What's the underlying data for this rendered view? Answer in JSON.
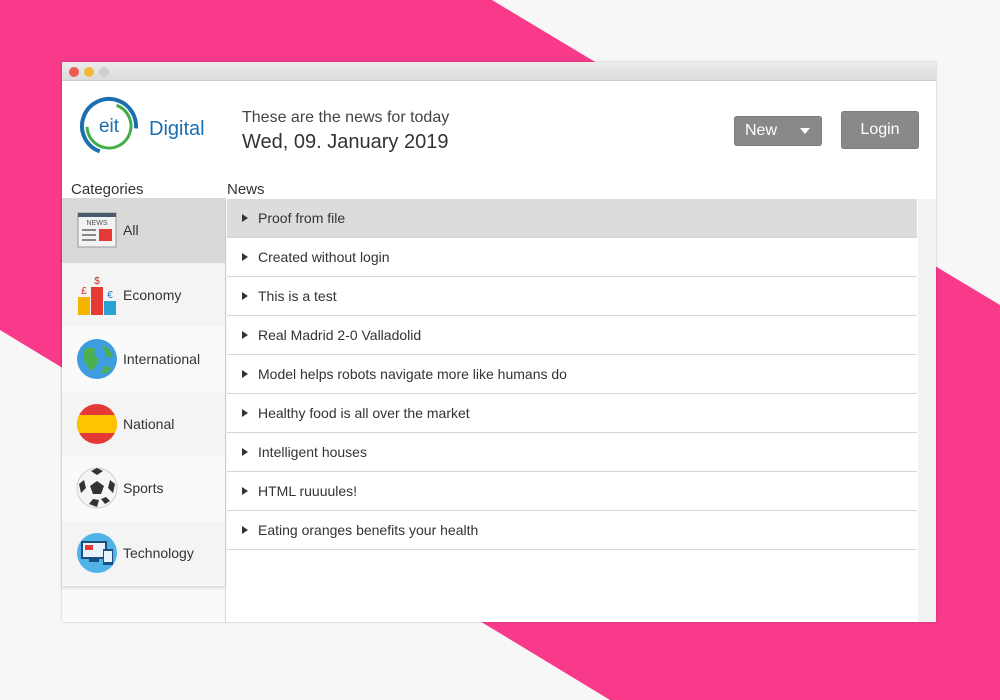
{
  "colors": {
    "accent_pink": "#f93a8b",
    "brand_blue": "#1b6fb0",
    "brand_green": "#3fae49",
    "button_gray": "#898989"
  },
  "header": {
    "logo_mark": "eit",
    "logo_text": "Digital",
    "subtitle": "These are the news for today",
    "date": "Wed, 09. January 2019",
    "new_button": "New",
    "login_button": "Login"
  },
  "labels": {
    "categories": "Categories",
    "news": "News"
  },
  "categories": [
    {
      "label": "All",
      "icon": "newspaper-icon",
      "selected": true
    },
    {
      "label": "Economy",
      "icon": "currency-podium-icon"
    },
    {
      "label": "International",
      "icon": "globe-icon"
    },
    {
      "label": "National",
      "icon": "spain-flag-icon"
    },
    {
      "label": "Sports",
      "icon": "soccer-ball-icon"
    },
    {
      "label": "Technology",
      "icon": "computer-devices-icon"
    }
  ],
  "news": [
    {
      "title": "Proof from file",
      "selected": true
    },
    {
      "title": "Created without login"
    },
    {
      "title": "This is a test"
    },
    {
      "title": "Real Madrid 2-0 Valladolid"
    },
    {
      "title": "Model helps robots navigate more like humans do"
    },
    {
      "title": "Healthy food is all over the market"
    },
    {
      "title": "Intelligent houses"
    },
    {
      "title": "HTML ruuuules!"
    },
    {
      "title": "Eating oranges benefits your health"
    }
  ]
}
